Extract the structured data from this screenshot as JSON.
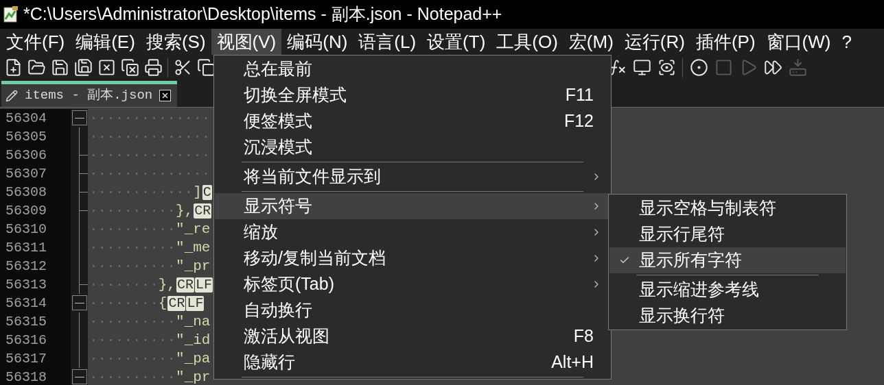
{
  "window": {
    "title": "*C:\\Users\\Administrator\\Desktop\\items - 副本.json - Notepad++"
  },
  "menu_bar": [
    {
      "label": "文件(F)",
      "selected": false
    },
    {
      "label": "编辑(E)",
      "selected": false
    },
    {
      "label": "搜索(S)",
      "selected": false
    },
    {
      "label": "视图(V)",
      "selected": true
    },
    {
      "label": "编码(N)",
      "selected": false
    },
    {
      "label": "语言(L)",
      "selected": false
    },
    {
      "label": "设置(T)",
      "selected": false
    },
    {
      "label": "工具(O)",
      "selected": false
    },
    {
      "label": "宏(M)",
      "selected": false
    },
    {
      "label": "运行(R)",
      "selected": false
    },
    {
      "label": "插件(P)",
      "selected": false
    },
    {
      "label": "窗口(W)",
      "selected": false
    },
    {
      "label": "?",
      "selected": false
    }
  ],
  "toolbar": {
    "left": [
      {
        "disabled": false
      },
      {
        "disabled": false
      },
      {
        "disabled": false
      },
      {
        "disabled": false
      },
      {
        "disabled": false
      },
      {
        "disabled": false
      },
      {
        "disabled": false
      },
      {
        "disabled": false
      },
      {
        "disabled": false
      }
    ],
    "right": [
      {
        "disabled": false
      },
      {
        "disabled": false
      },
      {
        "disabled": false
      },
      {
        "disabled": false
      },
      {
        "disabled": true
      },
      {
        "disabled": true
      },
      {
        "disabled": false
      },
      {
        "disabled": true
      }
    ]
  },
  "tabs": [
    {
      "label": "items - 副本.json",
      "selected": true
    }
  ],
  "editor": {
    "lines": [
      {
        "number": "56304",
        "kind": "fold_open",
        "code": "··············"
      },
      {
        "number": "56305",
        "kind": "fold_line",
        "code": "··············"
      },
      {
        "number": "56306",
        "kind": "fold_end",
        "code": "··············"
      },
      {
        "number": "56307",
        "kind": "fold_end",
        "code": "··············"
      },
      {
        "number": "56308",
        "kind": "fold_end",
        "code": "············]",
        "eol": [
          "C"
        ]
      },
      {
        "number": "56309",
        "kind": "fold_end",
        "code": "··········},",
        "eol": [
          "CR"
        ]
      },
      {
        "number": "56310",
        "kind": "fold_line",
        "code": "··········\"_re"
      },
      {
        "number": "56311",
        "kind": "fold_line",
        "code": "··········\"_me"
      },
      {
        "number": "56312",
        "kind": "fold_line",
        "code": "··········\"_pr"
      },
      {
        "number": "56313",
        "kind": "fold_end",
        "code": "········},",
        "eol": [
          "CR",
          "LF"
        ]
      },
      {
        "number": "56314",
        "kind": "fold_open",
        "code": "········{",
        "eol": [
          "CR",
          "LF"
        ]
      },
      {
        "number": "56315",
        "kind": "fold_line",
        "code": "··········\"_na"
      },
      {
        "number": "56316",
        "kind": "fold_line",
        "code": "··········\"_id"
      },
      {
        "number": "56317",
        "kind": "fold_line",
        "code": "··········\"_pa"
      },
      {
        "number": "56318",
        "kind": "fold_open",
        "code": "··········\"_pr"
      }
    ]
  },
  "view_menu": [
    {
      "kind": "item",
      "label": "总在最前",
      "selected": false,
      "submenu": false
    },
    {
      "kind": "item",
      "label": "切换全屏模式",
      "shortcut": "F11",
      "selected": false,
      "submenu": false
    },
    {
      "kind": "item",
      "label": "便签模式",
      "shortcut": "F12",
      "selected": false,
      "submenu": false
    },
    {
      "kind": "item",
      "label": "沉浸模式",
      "selected": false,
      "submenu": false
    },
    {
      "kind": "separator"
    },
    {
      "kind": "item",
      "label": "将当前文件显示到",
      "selected": false,
      "submenu": true
    },
    {
      "kind": "separator"
    },
    {
      "kind": "item",
      "label": "显示符号",
      "selected": true,
      "submenu": true
    },
    {
      "kind": "item",
      "label": "缩放",
      "selected": false,
      "submenu": true
    },
    {
      "kind": "item",
      "label": "移动/复制当前文档",
      "selected": false,
      "submenu": true
    },
    {
      "kind": "item",
      "label": "标签页(Tab)",
      "selected": false,
      "submenu": true
    },
    {
      "kind": "item",
      "label": "自动换行",
      "selected": false,
      "submenu": false
    },
    {
      "kind": "item",
      "label": "激活从视图",
      "shortcut": "F8",
      "selected": false,
      "submenu": false
    },
    {
      "kind": "item",
      "label": "隐藏行",
      "shortcut": "Alt+H",
      "selected": false,
      "submenu": false
    },
    {
      "kind": "separator"
    }
  ],
  "symbols_submenu": [
    {
      "kind": "item",
      "label": "显示空格与制表符",
      "selected": false,
      "checked": false
    },
    {
      "kind": "item",
      "label": "显示行尾符",
      "selected": false,
      "checked": false
    },
    {
      "kind": "item",
      "label": "显示所有字符",
      "selected": true,
      "checked": true
    },
    {
      "kind": "separator"
    },
    {
      "kind": "item",
      "label": "显示缩进参考线",
      "selected": false,
      "checked": false
    },
    {
      "kind": "item",
      "label": "显示换行符",
      "selected": false,
      "checked": false
    }
  ]
}
